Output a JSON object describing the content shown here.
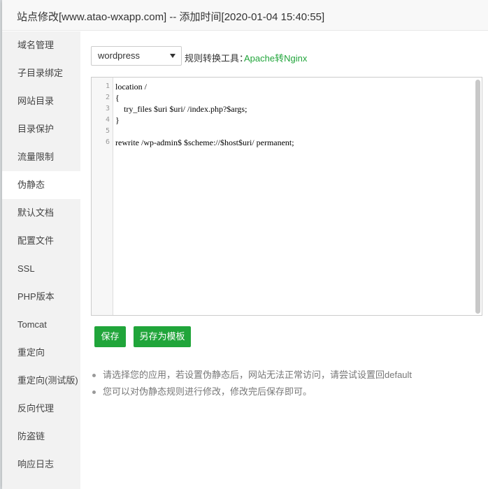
{
  "dialog": {
    "title": "站点修改[www.atao-wxapp.com] -- 添加时间[2020-01-04 15:40:55]"
  },
  "sidebar": {
    "items": [
      {
        "label": "域名管理"
      },
      {
        "label": "子目录绑定"
      },
      {
        "label": "网站目录"
      },
      {
        "label": "目录保护"
      },
      {
        "label": "流量限制"
      },
      {
        "label": "伪静态",
        "active": true
      },
      {
        "label": "默认文档"
      },
      {
        "label": "配置文件"
      },
      {
        "label": "SSL"
      },
      {
        "label": "PHP版本"
      },
      {
        "label": "Tomcat"
      },
      {
        "label": "重定向"
      },
      {
        "label": "重定向(测试版)"
      },
      {
        "label": "反向代理"
      },
      {
        "label": "防盗链"
      },
      {
        "label": "响应日志"
      }
    ]
  },
  "rewrite": {
    "template_select": "wordpress",
    "tool_label": "规则转换工具：",
    "tool_link": "Apache转Nginx"
  },
  "editor": {
    "line_numbers": [
      "1",
      "2",
      "3",
      "4",
      "5",
      "6"
    ],
    "lines": [
      "location /",
      "{",
      "\ttry_files $uri $uri/ /index.php?$args;",
      "}",
      "",
      "rewrite /wp-admin$ $scheme://$host$uri/ permanent;"
    ]
  },
  "buttons": {
    "save": "保存",
    "save_as_template": "另存为模板"
  },
  "tips": [
    "请选择您的应用，若设置伪静态后，网站无法正常访问，请尝试设置回default",
    "您可以对伪静态规则进行修改，修改完后保存即可。"
  ],
  "colors": {
    "accent": "#20a53a",
    "sidebar_bg": "#f2f2f2"
  }
}
